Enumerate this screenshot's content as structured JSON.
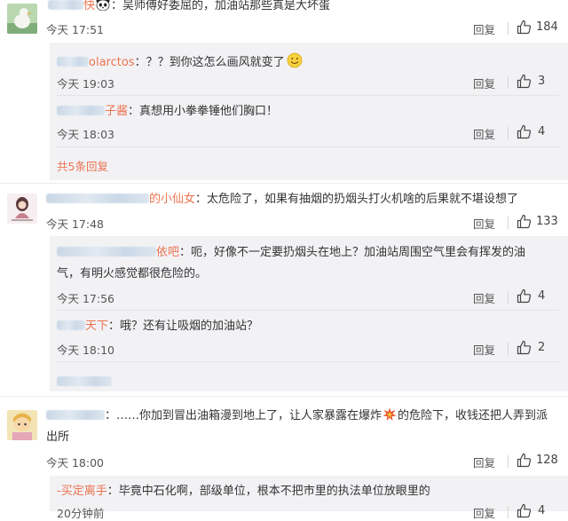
{
  "comments": [
    {
      "name": "快",
      "text": "：吴师傅好委屈的，加油站那些真是大坏蛋",
      "time": "今天 17:51",
      "reply": "回复",
      "likes": "184",
      "replies": [
        {
          "name": "olarctos",
          "text": "：？？到你这怎么画风就变了",
          "time": "今天 19:03",
          "reply": "回复",
          "likes": "3"
        },
        {
          "name": "子酱",
          "text": "：真想用小拳拳锤他们胸口！",
          "time": "今天 18:03",
          "reply": "回复",
          "likes": "4"
        }
      ],
      "more": "共5条回复"
    },
    {
      "name": "的小仙女",
      "text": "：太危险了，如果有抽烟的扔烟头打火机啥的后果就不堪设想了",
      "time": "今天 17:48",
      "reply": "回复",
      "likes": "133",
      "replies": [
        {
          "name": "依吧",
          "text": "：呃，好像不一定要扔烟头在地上？加油站周围空气里会有挥发的油",
          "text2": "气，有明火感觉都很危险的。",
          "time": "今天 17:56",
          "reply": "回复",
          "likes": "4"
        },
        {
          "name": "天下",
          "text": "：哦？还有让吸烟的加油站？",
          "time": "今天 18:10",
          "reply": "回复",
          "likes": "2"
        }
      ]
    },
    {
      "name": "",
      "text": "：……你加到冒出油箱漫到地上了，让人家暴露在爆炸",
      "text_b": "的危险下，收钱还把人弄到派",
      "text2": "出所",
      "time": "今天 18:00",
      "reply": "回复",
      "likes": "128",
      "replies": [
        {
          "name": "-买定离手",
          "text": "：毕竟中石化啊，部级单位，根本不把市里的执法单位放眼里的",
          "time": "20分钟前",
          "reply": "回复",
          "likes": "4"
        }
      ]
    }
  ],
  "colors": {
    "accent": "#eb7350",
    "subbox": "#f2f2f5"
  },
  "icons": [
    "panda-emoji",
    "smile-emoji",
    "explosion-emoji",
    "thumbs-up-icon"
  ]
}
